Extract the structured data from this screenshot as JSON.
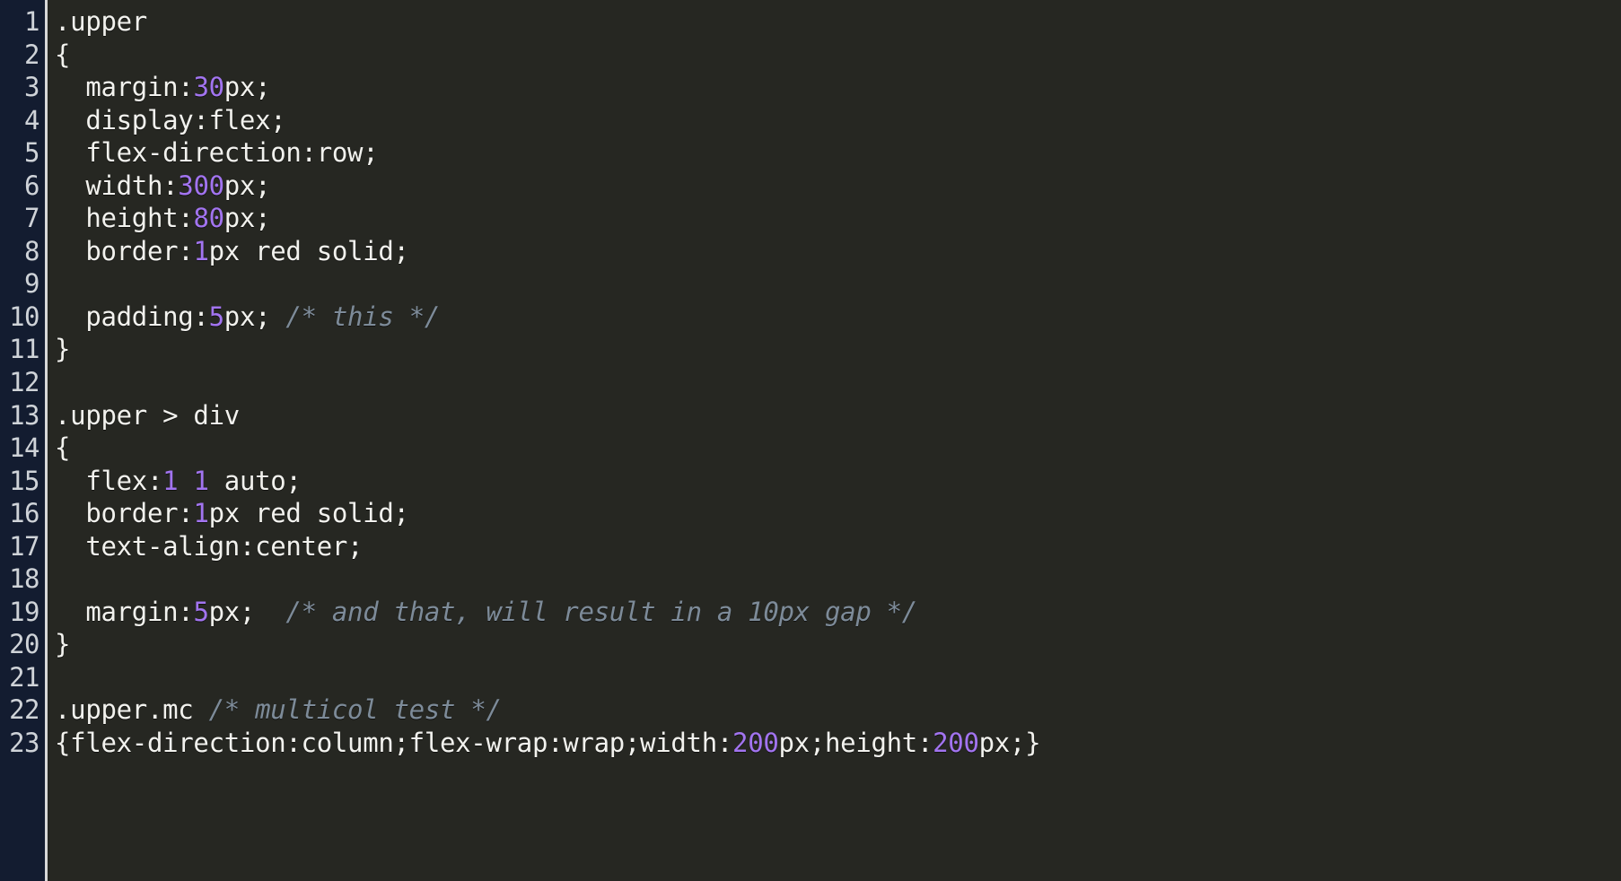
{
  "editor": {
    "theme_name": "dark-code-editor",
    "colors": {
      "background": "#262722",
      "gutter_background": "#131c30",
      "gutter_rule": "#d8d8d8",
      "line_number_text": "#cfd3d8",
      "code_text": "#f2f2ee",
      "number_token": "#a274f0",
      "comment_token": "#7d8b99"
    },
    "language": "CSS",
    "first_visible_line": 1,
    "last_visible_line": 23,
    "lines": [
      {
        "number": "1",
        "tokens": [
          {
            "t": "plain",
            "s": ".upper"
          }
        ]
      },
      {
        "number": "2",
        "tokens": [
          {
            "t": "plain",
            "s": "{"
          }
        ]
      },
      {
        "number": "3",
        "tokens": [
          {
            "t": "plain",
            "s": "  margin:"
          },
          {
            "t": "number",
            "s": "30"
          },
          {
            "t": "plain",
            "s": "px;"
          }
        ]
      },
      {
        "number": "4",
        "tokens": [
          {
            "t": "plain",
            "s": "  display:flex;"
          }
        ]
      },
      {
        "number": "5",
        "tokens": [
          {
            "t": "plain",
            "s": "  flex-direction:row;"
          }
        ]
      },
      {
        "number": "6",
        "tokens": [
          {
            "t": "plain",
            "s": "  width:"
          },
          {
            "t": "number",
            "s": "300"
          },
          {
            "t": "plain",
            "s": "px;"
          }
        ]
      },
      {
        "number": "7",
        "tokens": [
          {
            "t": "plain",
            "s": "  height:"
          },
          {
            "t": "number",
            "s": "80"
          },
          {
            "t": "plain",
            "s": "px;"
          }
        ]
      },
      {
        "number": "8",
        "tokens": [
          {
            "t": "plain",
            "s": "  border:"
          },
          {
            "t": "number",
            "s": "1"
          },
          {
            "t": "plain",
            "s": "px red solid;"
          }
        ]
      },
      {
        "number": "9",
        "tokens": []
      },
      {
        "number": "10",
        "tokens": [
          {
            "t": "plain",
            "s": "  padding:"
          },
          {
            "t": "number",
            "s": "5"
          },
          {
            "t": "plain",
            "s": "px; "
          },
          {
            "t": "comment",
            "s": "/* this */"
          }
        ]
      },
      {
        "number": "11",
        "tokens": [
          {
            "t": "plain",
            "s": "}"
          }
        ]
      },
      {
        "number": "12",
        "tokens": []
      },
      {
        "number": "13",
        "tokens": [
          {
            "t": "plain",
            "s": ".upper > div"
          }
        ]
      },
      {
        "number": "14",
        "tokens": [
          {
            "t": "plain",
            "s": "{"
          }
        ]
      },
      {
        "number": "15",
        "tokens": [
          {
            "t": "plain",
            "s": "  flex:"
          },
          {
            "t": "number",
            "s": "1"
          },
          {
            "t": "plain",
            "s": " "
          },
          {
            "t": "number",
            "s": "1"
          },
          {
            "t": "plain",
            "s": " auto;"
          }
        ]
      },
      {
        "number": "16",
        "tokens": [
          {
            "t": "plain",
            "s": "  border:"
          },
          {
            "t": "number",
            "s": "1"
          },
          {
            "t": "plain",
            "s": "px red solid;"
          }
        ]
      },
      {
        "number": "17",
        "tokens": [
          {
            "t": "plain",
            "s": "  text-align:center;"
          }
        ]
      },
      {
        "number": "18",
        "tokens": []
      },
      {
        "number": "19",
        "tokens": [
          {
            "t": "plain",
            "s": "  margin:"
          },
          {
            "t": "number",
            "s": "5"
          },
          {
            "t": "plain",
            "s": "px;  "
          },
          {
            "t": "comment",
            "s": "/* and that, will result in a 10px gap */"
          }
        ]
      },
      {
        "number": "20",
        "tokens": [
          {
            "t": "plain",
            "s": "}"
          }
        ]
      },
      {
        "number": "21",
        "tokens": []
      },
      {
        "number": "22",
        "tokens": [
          {
            "t": "plain",
            "s": ".upper.mc "
          },
          {
            "t": "comment",
            "s": "/* multicol test */"
          }
        ]
      },
      {
        "number": "23",
        "tokens": [
          {
            "t": "plain",
            "s": "{flex-direction:column;flex-wrap:wrap;width:"
          },
          {
            "t": "number",
            "s": "200"
          },
          {
            "t": "plain",
            "s": "px;height:"
          },
          {
            "t": "number",
            "s": "200"
          },
          {
            "t": "plain",
            "s": "px;}"
          }
        ]
      }
    ]
  }
}
